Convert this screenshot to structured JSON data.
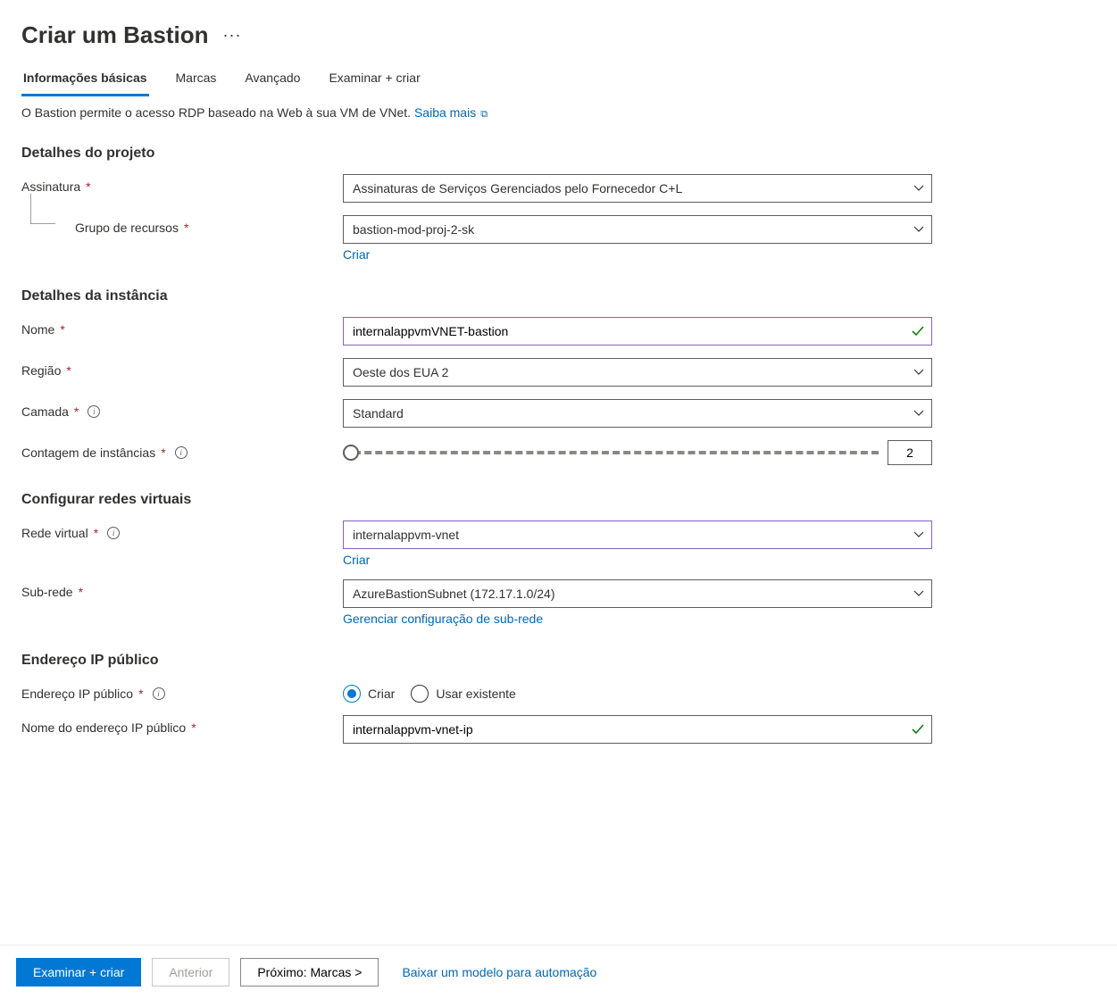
{
  "header": {
    "title": "Criar um Bastion"
  },
  "tabs": [
    {
      "label": "Informações básicas",
      "active": true
    },
    {
      "label": "Marcas",
      "active": false
    },
    {
      "label": "Avançado",
      "active": false
    },
    {
      "label": "Examinar + criar",
      "active": false
    }
  ],
  "intro": {
    "text": "O Bastion permite o acesso RDP baseado na Web à sua VM de VNet. ",
    "link": "Saiba mais"
  },
  "sections": {
    "project": {
      "heading": "Detalhes do projeto",
      "subscription": {
        "label": "Assinatura",
        "value": "Assinaturas de Serviços Gerenciados pelo Fornecedor C+L"
      },
      "resourceGroup": {
        "label": "Grupo de recursos",
        "value": "bastion-mod-proj-2-sk",
        "createLink": "Criar"
      }
    },
    "instance": {
      "heading": "Detalhes da instância",
      "name": {
        "label": "Nome",
        "value": "internalappvmVNET-bastion"
      },
      "region": {
        "label": "Região",
        "value": "Oeste dos EUA 2"
      },
      "tier": {
        "label": "Camada",
        "value": "Standard"
      },
      "instanceCount": {
        "label": "Contagem de instâncias",
        "value": "2"
      }
    },
    "vnet": {
      "heading": "Configurar redes virtuais",
      "vnet": {
        "label": "Rede virtual",
        "value": "internalappvm-vnet",
        "createLink": "Criar"
      },
      "subnet": {
        "label": "Sub-rede",
        "value": "AzureBastionSubnet (172.17.1.0/24)",
        "manageLink": "Gerenciar configuração de sub-rede"
      }
    },
    "publicIp": {
      "heading": "Endereço IP público",
      "address": {
        "label": "Endereço IP público",
        "options": {
          "create": "Criar",
          "existing": "Usar existente"
        },
        "selected": "create"
      },
      "name": {
        "label": "Nome do endereço IP público",
        "value": "internalappvm-vnet-ip"
      }
    }
  },
  "footer": {
    "review": "Examinar + criar",
    "previous": "Anterior",
    "next": "Próximo: Marcas >",
    "downloadTemplate": "Baixar um modelo para automação"
  }
}
